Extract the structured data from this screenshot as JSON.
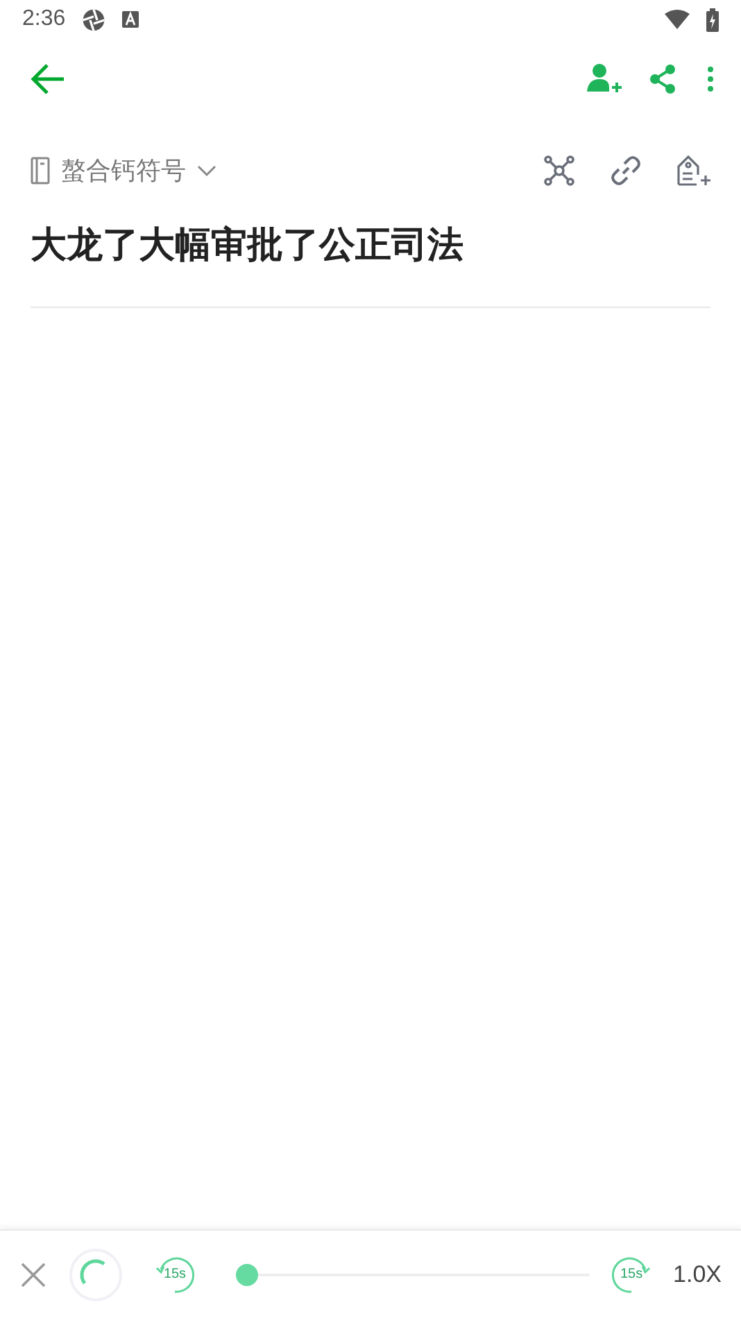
{
  "status_bar": {
    "time": "2:36"
  },
  "notebook": {
    "name": "螯合钙符号"
  },
  "note": {
    "title": "大龙了大幅审批了公正司法"
  },
  "player": {
    "rewind_label": "15s",
    "forward_label": "15s",
    "level": 0,
    "speed": "1.0X"
  }
}
